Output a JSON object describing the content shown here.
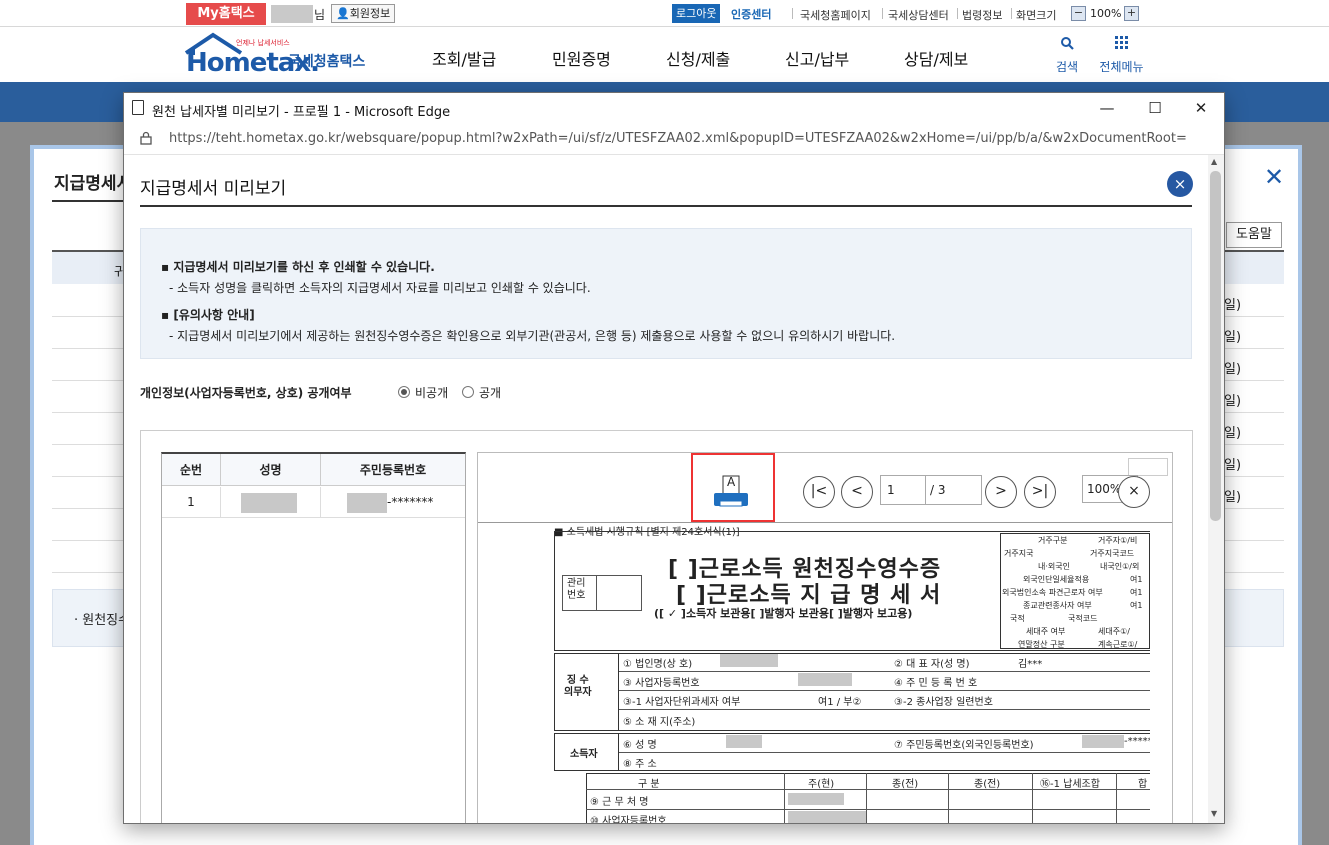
{
  "topbar": {
    "my_hometax": "My홈택스",
    "nim": "님",
    "member_info": "회원정보",
    "logout": "로그아웃",
    "cert_center": "인증센터",
    "links": [
      "국세청홈페이지",
      "국세상담센터",
      "법령정보",
      "화면크기"
    ],
    "zoom_minus": "−",
    "zoom_value": "100%",
    "zoom_plus": "+"
  },
  "header": {
    "logo_word": "Hometax.",
    "logo_kor": "국세청홈택스",
    "logo_small": "언제나 납세서비스",
    "gnb": [
      "조회/발급",
      "민원증명",
      "신청/제출",
      "신고/납부",
      "상담/제보"
    ],
    "search_label": "검색",
    "allmenu_label": "전체메뉴"
  },
  "bg_modal": {
    "title": "지급명세서",
    "help": "도움말",
    "thead_fragment": "귀",
    "row_fragment": "일)",
    "note": "원천징수"
  },
  "edge": {
    "title": "원천 납세자별 미리보기 - 프로필 1 - Microsoft Edge",
    "url": "https://teht.hometax.go.kr/websquare/popup.html?w2xPath=/ui/sf/z/UTESFZAA02.xml&popupID=UTESFZAA02&w2xHome=/ui/pp/b/a/&w2xDocumentRoot=",
    "minimize": "—",
    "maximize": "☐",
    "close": "✕"
  },
  "popup": {
    "title": "지급명세서 미리보기",
    "close": "×",
    "info_1_title": "지급명세서 미리보기를 하신 후 인쇄할 수 있습니다.",
    "info_1_desc": "- 소득자 성명을 클릭하면 소득자의 지급명세서 자료를 미리보고 인쇄할 수 있습니다.",
    "info_2_title": "[유의사항 안내]",
    "info_2_desc": "- 지급명세서 미리보기에서 제공하는 원천징수영수증은 확인용으로 외부기관(관공서, 은행 등) 제출용으로 사용할 수 없으니 유의하시기 바랍니다.",
    "privacy_label": "개인정보(사업자등록번호, 상호) 공개여부",
    "privacy_options": [
      "비공개",
      "공개"
    ],
    "privacy_selected": "비공개"
  },
  "list_table": {
    "headers": [
      "순번",
      "성명",
      "주민등록번호"
    ],
    "rows": [
      {
        "no": "1",
        "name": "",
        "rrn_suffix": "-*******"
      }
    ]
  },
  "viewer": {
    "first": "|<",
    "prev": "<",
    "page_current": "1",
    "page_total": "/ 3",
    "next": ">",
    "last": ">|",
    "zoom": "100%",
    "close": "×",
    "print_letter": "A"
  },
  "form": {
    "top_caption": "■ 소득세법 시행규칙 [별지 제24호서식(1)]",
    "title_1": "[ ]근로소득 원천징수영수증",
    "title_2": "[ ]근로소득 지 급 명 세 서",
    "subtitle": "([ ✓ ]소득자 보관용[   ]발행자 보관용[   ]발행자 보고용)",
    "mgmt_no": "관리\n번호",
    "right_box": [
      "거주구분",
      "거주자①/비",
      "거주지국",
      "거주지국코드",
      "내·외국인",
      "내국인①/외",
      "외국인단일세율적용",
      "여1",
      "외국법인소속 파견근로자 여부",
      "여1",
      "종교관련종사자 여부",
      "여1",
      "국적",
      "국적코드",
      "세대주 여부",
      "세대주①/",
      "연말정산 구분",
      "계속근로①/"
    ],
    "payer_label": "징 수\n의무자",
    "payer_rows": [
      "① 법인명(상 호)",
      "② 대 표 자(성 명)",
      "③ 사업자등록번호",
      "④ 주 민 등 록 번 호",
      "③-1 사업자단위과세자 여부",
      "여1 / 부②",
      "③-2 종사업장 일련번호",
      "⑤ 소 재 지(주소)"
    ],
    "rep_name": "김***",
    "earner_label": "소득자",
    "earner_rows": [
      "⑥ 성      명",
      "⑦ 주민등록번호(외국인등록번호)",
      "⑧ 주      소"
    ],
    "earner_rrn_suffix": "-*****",
    "grid_headers": [
      "구 분",
      "주(현)",
      "종(전)",
      "종(전)",
      "⑯-1 납세조합",
      "합"
    ],
    "grid_rows": [
      "⑨ 근 무 처 명",
      "⑩ 사업자등록번호"
    ]
  }
}
